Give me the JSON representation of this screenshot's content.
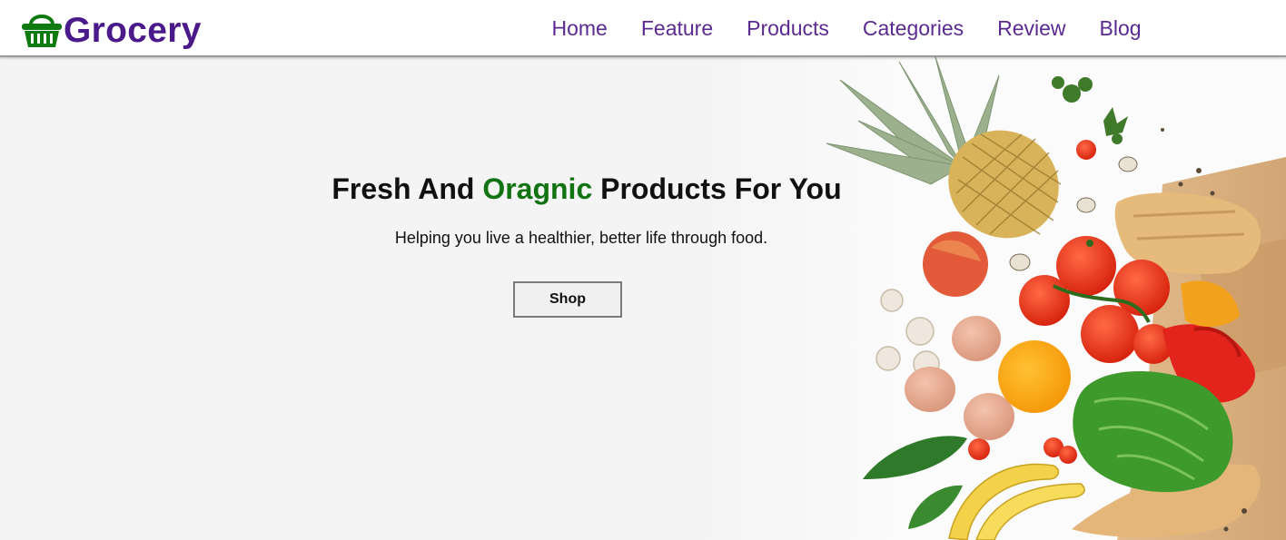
{
  "header": {
    "logo_text": "Grocery",
    "logo_icon": "shopping-basket-icon",
    "nav": [
      {
        "label": "Home"
      },
      {
        "label": "Feature"
      },
      {
        "label": "Products"
      },
      {
        "label": "Categories"
      },
      {
        "label": "Review"
      },
      {
        "label": "Blog"
      }
    ]
  },
  "hero": {
    "title_part1": "Fresh And ",
    "title_accent": "Oragnic",
    "title_part2": " Products For You",
    "subtitle": "Helping you live a healthier, better life through food.",
    "button_label": "Shop",
    "image": "fresh-produce-grocery-bag-image"
  },
  "colors": {
    "brand_purple": "#4a1a8a",
    "nav_purple": "#5b2a91",
    "accent_green": "#127312",
    "hero_background": "#f4f4f4"
  }
}
